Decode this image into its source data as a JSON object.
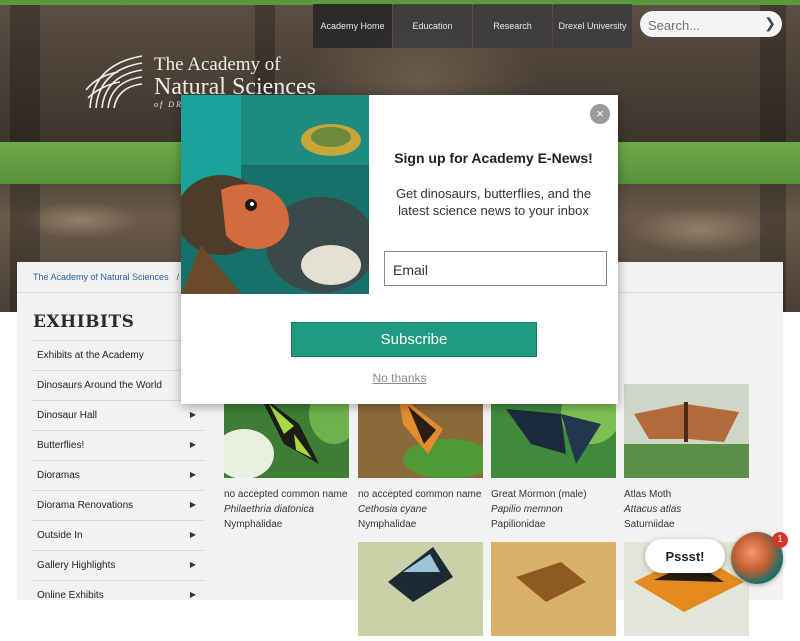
{
  "header": {
    "logo": {
      "line1": "The Academy of",
      "line2": "Natural Sciences",
      "line3": "of DREXEL UNIVERSITY"
    },
    "nav": [
      {
        "label": "Academy Home"
      },
      {
        "label": "Education"
      },
      {
        "label": "Research"
      },
      {
        "label": "Drexel University"
      }
    ],
    "search": {
      "placeholder": "Search..."
    }
  },
  "breadcrumb": {
    "root": "The Academy of Natural Sciences",
    "separator": "/"
  },
  "sidebar": {
    "title": "EXHIBITS",
    "items": [
      {
        "label": "Exhibits at the Academy",
        "has_arrow": false
      },
      {
        "label": "Dinosaurs Around the World",
        "has_arrow": false
      },
      {
        "label": "Dinosaur Hall",
        "has_arrow": true
      },
      {
        "label": "Butterflies!",
        "has_arrow": true
      },
      {
        "label": "Dioramas",
        "has_arrow": true
      },
      {
        "label": "Diorama Renovations",
        "has_arrow": true
      },
      {
        "label": "Outside In",
        "has_arrow": true
      },
      {
        "label": "Gallery Highlights",
        "has_arrow": true
      },
      {
        "label": "Online Exhibits",
        "has_arrow": true
      }
    ]
  },
  "butterflies": [
    {
      "common": "no accepted common name",
      "scientific": "Philaethria diatonica",
      "family": "Nymphalidae"
    },
    {
      "common": "no accepted common name",
      "scientific": "Cethosia cyane",
      "family": "Nymphalidae"
    },
    {
      "common": "Great Mormon (male)",
      "scientific": "Papilio memnon",
      "family": "Papilionidae"
    },
    {
      "common": "Atlas Moth",
      "scientific": "Attacus atlas",
      "family": "Saturniidae"
    }
  ],
  "modal": {
    "title": "Sign up for Academy E-News!",
    "subtitle": "Get dinosaurs, butterflies, and the latest science news to your inbox",
    "email_placeholder": "Email",
    "subscribe_label": "Subscribe",
    "no_thanks_label": "No thanks",
    "close_label": "×"
  },
  "chat": {
    "bubble": "Pssst!",
    "badge": "1"
  },
  "colors": {
    "accent_green": "#5a9a3c",
    "subscribe": "#1f9b7f",
    "link": "#2a5f9e"
  }
}
